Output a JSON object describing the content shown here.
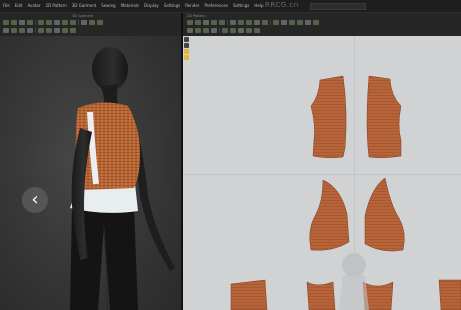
{
  "app": {
    "menu_items": [
      "File",
      "Edit",
      "Avatar",
      "2D Pattern",
      "3D Garment",
      "Sewing",
      "Materials",
      "Display",
      "Settings",
      "Render",
      "Preferences",
      "Settings",
      "Help"
    ],
    "watermark": "RRCG.cn",
    "search_placeholder": "",
    "toolbar_left_label": "3D Garment",
    "toolbar_right_label": "2D Pattern"
  },
  "colors": {
    "garment": "#c9703a",
    "pattern_piece": "#b7633a",
    "pattern_bg": "#d0d2d3",
    "viewport_bg": "#3a3a3a",
    "active_tool": "#e4b42c"
  },
  "icons": {
    "nav_prev": "chevron-left-icon"
  },
  "nav": {
    "prev_glyph": "‹"
  }
}
